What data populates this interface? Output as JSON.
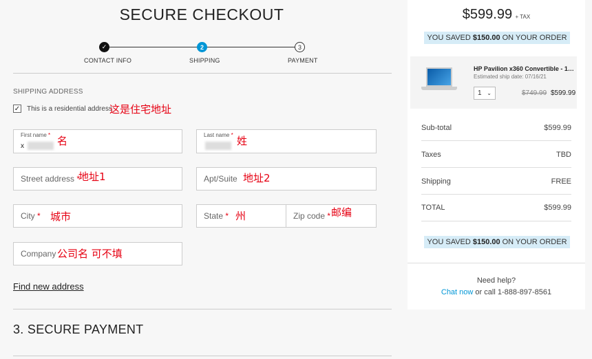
{
  "checkout": {
    "title": "SECURE CHECKOUT",
    "steps": [
      {
        "label": "CONTACT INFO",
        "marker": "✓"
      },
      {
        "label": "SHIPPING",
        "marker": "2"
      },
      {
        "label": "PAYMENT",
        "marker": "3"
      }
    ],
    "section_label": "SHIPPING ADDRESS",
    "residential_label": "This is a residential address",
    "fields": {
      "first_name": {
        "label": "First name",
        "value": "x"
      },
      "last_name": {
        "label": "Last name"
      },
      "street": {
        "label": "Street address"
      },
      "apt": {
        "label": "Apt/Suite"
      },
      "city": {
        "label": "City"
      },
      "state": {
        "label": "State"
      },
      "zip": {
        "label": "Zip code"
      },
      "company": {
        "label": "Company"
      }
    },
    "required_mark": "*",
    "find_address_link": "Find new address",
    "payment_title": "3. SECURE PAYMENT"
  },
  "annotations": {
    "residential": "这是住宅地址",
    "first_name": "名",
    "last_name": "姓",
    "street": "地址1",
    "apt": "地址2",
    "city": "城市",
    "state": "州",
    "zip": "邮编",
    "company": "公司名 可不填"
  },
  "summary": {
    "total": "$599.99",
    "tax_note": "+ TAX",
    "saved_prefix": "YOU SAVED",
    "saved_amount": "$150.00",
    "saved_suffix": "ON YOUR ORDER",
    "product": {
      "name": "HP Pavilion x360 Convertible - 15t...",
      "ship_date": "Estimated ship date: 07/16/21",
      "qty": "1",
      "old_price": "$749.99",
      "price": "$599.99"
    },
    "rows": [
      {
        "label": "Sub-total",
        "value": "$599.99"
      },
      {
        "label": "Taxes",
        "value": "TBD"
      },
      {
        "label": "Shipping",
        "value": "FREE"
      },
      {
        "label": "TOTAL",
        "value": "$599.99"
      }
    ],
    "help_title": "Need help?",
    "chat_link": "Chat now",
    "call_text": "or call 1-888-897-8561"
  },
  "colors": {
    "accent": "#0096d6",
    "annotation": "#e60012",
    "saved_bg": "#d6ecf7"
  }
}
